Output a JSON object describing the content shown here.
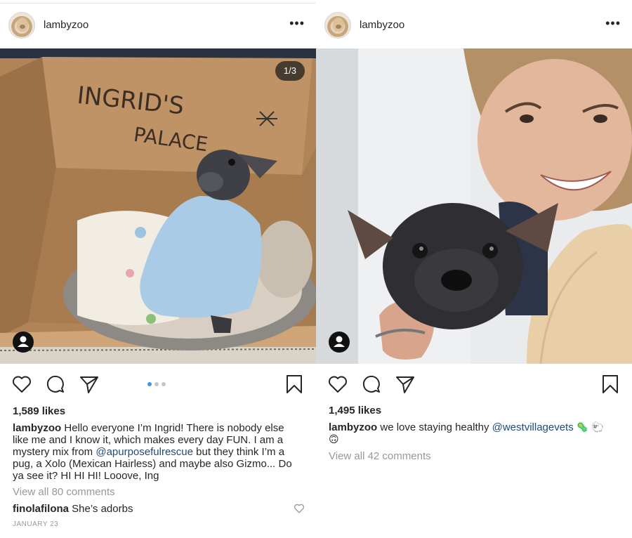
{
  "posts": [
    {
      "username": "lambyzoo",
      "more_label": "•••",
      "photo_counter": "1/3",
      "box_text": [
        "INGRID'S",
        "PALACE"
      ],
      "carousel": {
        "count": 3,
        "active_index": 0
      },
      "likes": "1,589 likes",
      "caption": {
        "user": "lambyzoo",
        "part1": "Hello everyone I’m Ingrid! There is nobody else like me and I know it, which makes every day FUN. I am a mystery mix from ",
        "mention": "@apurposefulrescue",
        "part2": " but they think I’m a pug, a Xolo (Mexican Hairless) and maybe also Gizmo... Do ya see it? HI HI HI! Looove, Ing"
      },
      "view_all": "View all 80 comments",
      "comment": {
        "user": "finolafilona",
        "text": "She’s adorbs"
      },
      "date": "JANUARY 23"
    },
    {
      "username": "lambyzoo",
      "more_label": "•••",
      "likes": "1,495 likes",
      "caption": {
        "user": "lambyzoo",
        "part1": "we love staying healthy ",
        "mention": "@westvillagevets",
        "emoji1": "🦠",
        "emoji2": "🐑",
        "emoji3": "🙃"
      },
      "view_all": "View all 42 comments"
    }
  ],
  "colors": {
    "mention": "#1f4a7a",
    "dot_active": "#3897f0",
    "muted": "#999999"
  },
  "icons": [
    "heart-icon",
    "comment-icon",
    "share-icon",
    "bookmark-icon",
    "user-tag-icon",
    "more-icon"
  ]
}
